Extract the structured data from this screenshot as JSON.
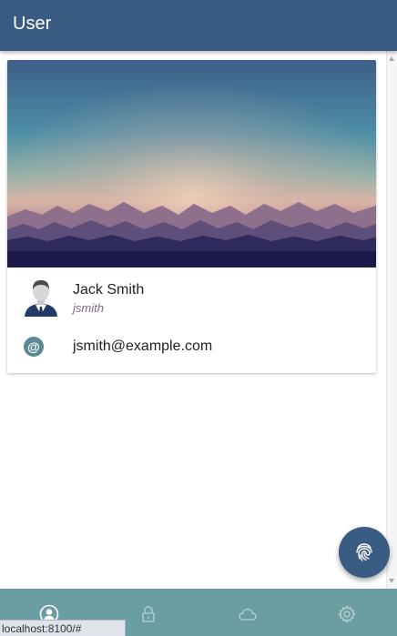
{
  "header": {
    "title": "User"
  },
  "profile": {
    "name": "Jack Smith",
    "handle": "jsmith",
    "email": "jsmith@example.com",
    "email_icon": "@"
  },
  "tabs": [
    {
      "icon": "user-icon",
      "active": true
    },
    {
      "icon": "lock-icon",
      "active": false
    },
    {
      "icon": "cloud-icon",
      "active": false
    },
    {
      "icon": "settings-icon",
      "active": false
    }
  ],
  "fab": {
    "icon": "fingerprint-icon"
  },
  "status_bar": {
    "url": "localhost:8100/#"
  },
  "colors": {
    "primary": "#3b5c82",
    "tabbar": "#6b9ea3",
    "email_icon_bg": "#5b8a95"
  }
}
